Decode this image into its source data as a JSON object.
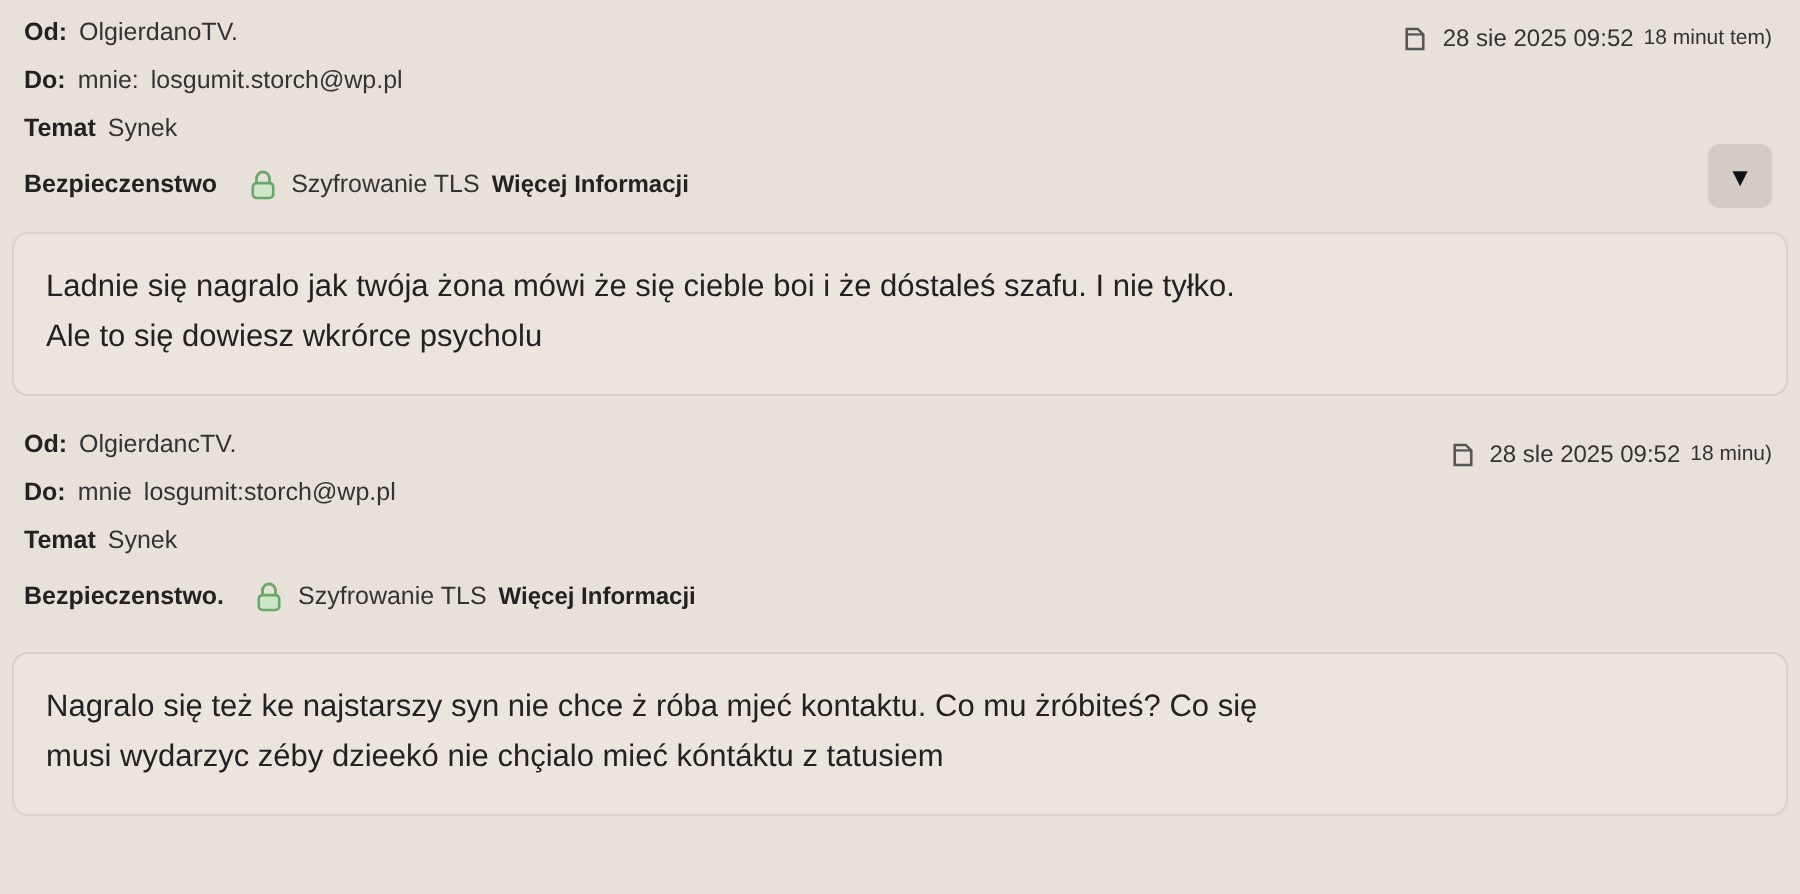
{
  "messages": [
    {
      "from_label": "Od:",
      "from": "OlgierdanoTV.",
      "to_label": "Do:",
      "to_name": "mnie:",
      "to_email": "losgumit.storch@wp.pl",
      "subject_label": "Temat",
      "subject": "Synek",
      "security_label": "Bezpieczenstwo",
      "encryption": "Szyfrowanie TLS",
      "more_info": "Więcej Informacji",
      "date": "28 sie 2025 09:52",
      "ago": "18 minut tem)",
      "menu_button": "▼",
      "body": [
        "Ladnie się nagralo jak twója żona mówi że się cieble boi i że dóstaleś szafu. I nie tyłko.",
        "Ale to się dowiesz wkrórce psycholu"
      ]
    },
    {
      "from_label": "Od:",
      "from": "OlgierdancTV.",
      "to_label": "Do:",
      "to_name": "mnie",
      "to_email": "losgumit:storch@wp.pl",
      "subject_label": "Temat",
      "subject": "Synek",
      "security_label": "Bezpieczenstwo.",
      "encryption": "Szyfrowanie TLS",
      "more_info": "Więcej Informacji",
      "date": "28 sle 2025 09:52",
      "ago": "18 minu)",
      "body": [
        "Nagralo się też ke najstarszy syn nie chce ż róba mjeć kontaktu. Co mu żróbiteś? Co się",
        "musi wydarzyc zéby dzieekó nie chçialo mieć kóntáktu z tatusiem"
      ]
    }
  ]
}
